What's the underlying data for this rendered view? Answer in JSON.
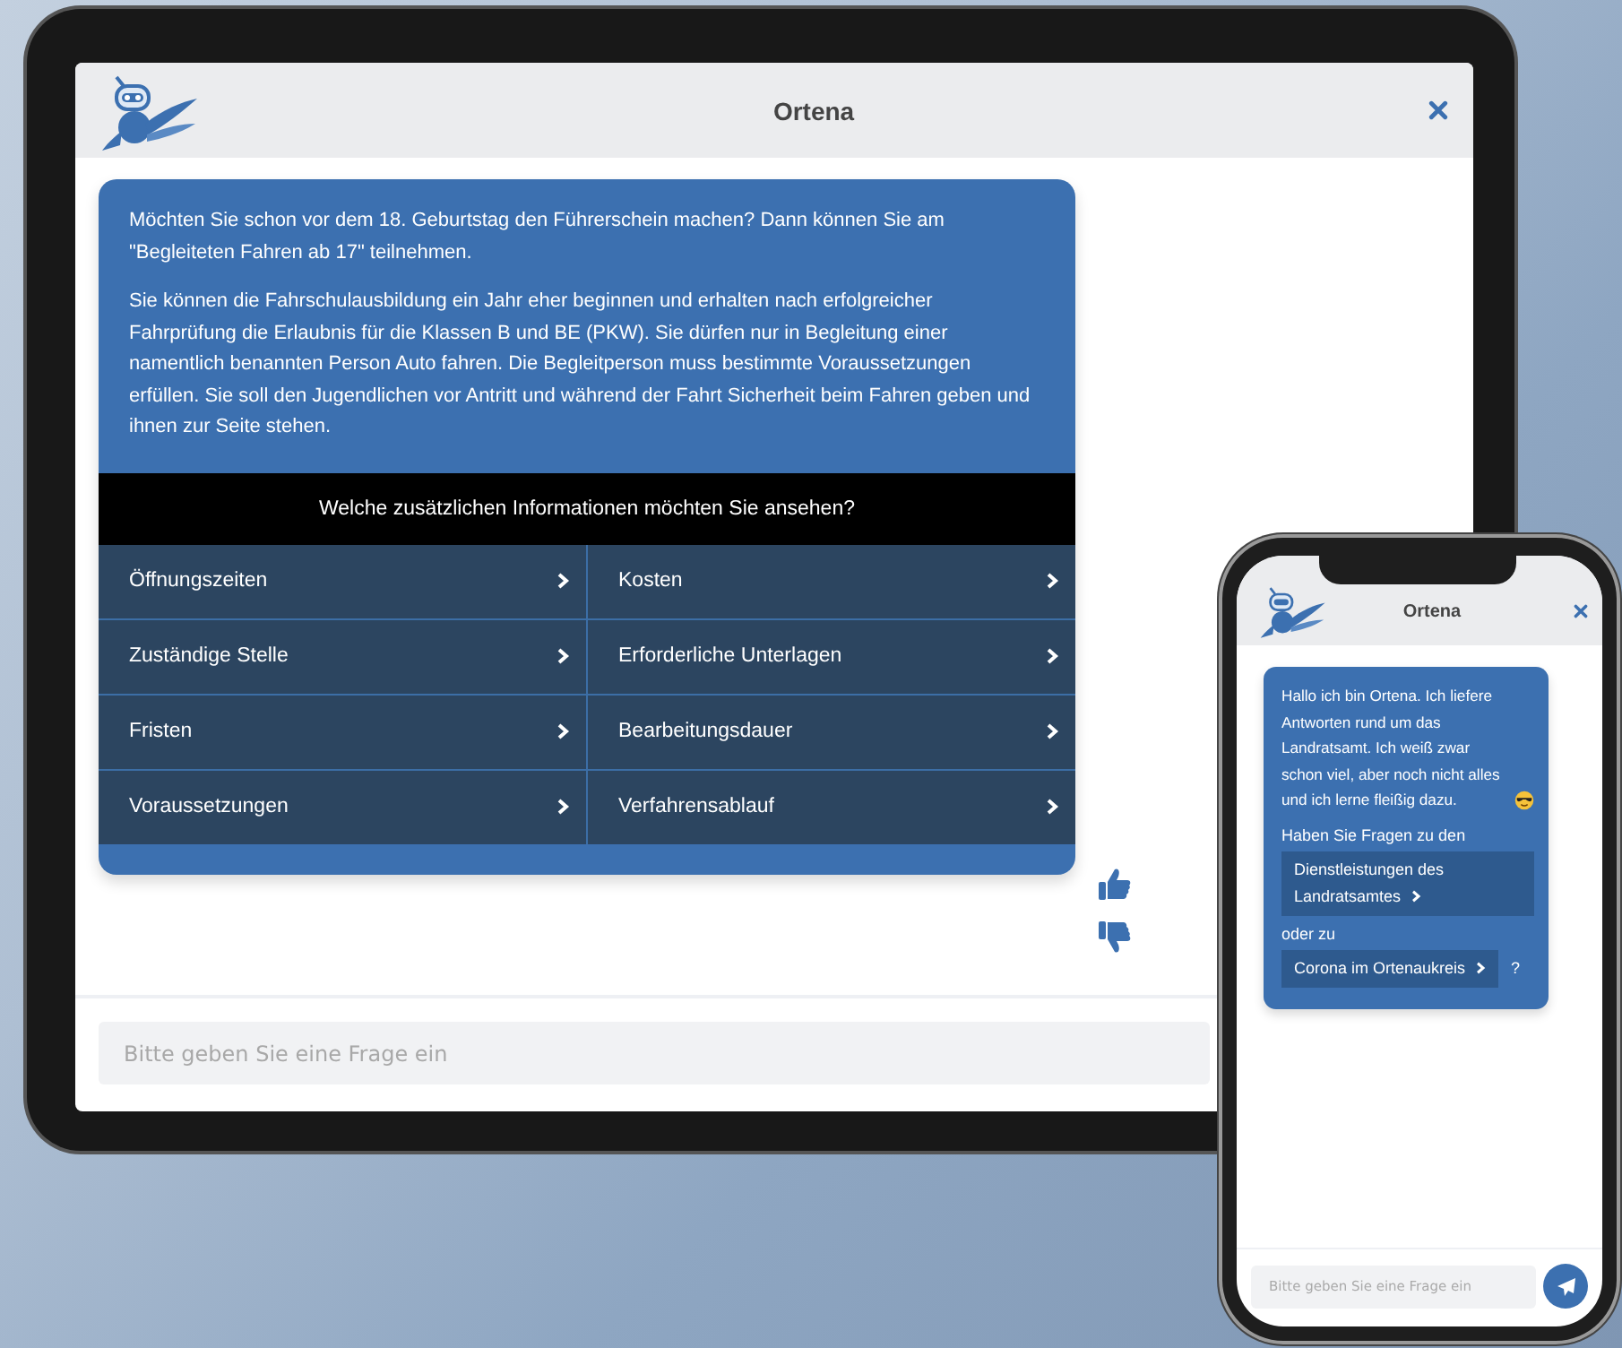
{
  "tablet": {
    "header": {
      "title": "Ortena"
    },
    "message": {
      "paragraphs": [
        "Möchten Sie schon vor dem 18. Geburtstag den Führerschein machen? Dann können Sie am \"Begleiteten Fahren ab 17\" teilnehmen.",
        "Sie können die Fahrschulausbildung ein Jahr eher beginnen und erhalten nach erfolgreicher Fahrprüfung die Erlaubnis für die Klassen B und BE (PKW). Sie dürfen nur in Begleitung einer namentlich benannten Person Auto fahren. Die Begleitperson muss bestimmte Voraussetzungen erfüllen. Sie soll den Jugendlichen vor Antritt und während der Fahrt Sicherheit beim Fahren geben und ihnen zur Seite stehen."
      ],
      "prompt": "Welche zusätzlichen Informationen möchten Sie ansehen?",
      "options": [
        "Öffnungszeiten",
        "Kosten",
        "Zuständige Stelle",
        "Erforderliche Unterlagen",
        "Fristen",
        "Bearbeitungsdauer",
        "Voraussetzungen",
        "Verfahrensablauf"
      ]
    },
    "input": {
      "placeholder": "Bitte geben Sie eine Frage ein"
    }
  },
  "phone": {
    "header": {
      "title": "Ortena"
    },
    "message": {
      "intro": "Hallo ich bin Ortena. Ich liefere Antworten rund um das Landratsamt. Ich weiß zwar schon viel, aber noch nicht alles und ich lerne fleißig dazu.",
      "items": [
        {
          "kind": "text",
          "text": "Haben Sie Fragen zu den"
        },
        {
          "kind": "link",
          "label": "Dienstleistungen des Landratsamtes"
        },
        {
          "kind": "text",
          "text": "oder zu"
        },
        {
          "kind": "link",
          "label": "Corona im Ortenaukreis",
          "suffix": "?"
        }
      ]
    },
    "input": {
      "placeholder": "Bitte geben Sie eine Frage ein"
    }
  }
}
